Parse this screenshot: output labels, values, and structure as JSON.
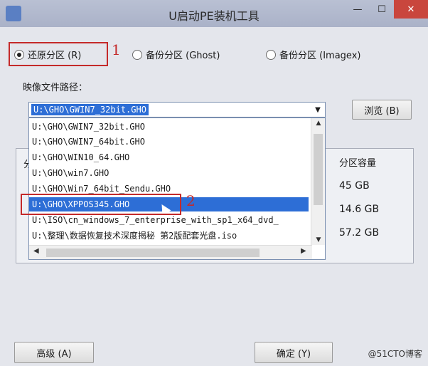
{
  "window": {
    "title": "U启动PE装机工具",
    "minimize": "—",
    "maximize": "☐",
    "close": "✕"
  },
  "restore_options": [
    {
      "label": "还原分区 (R)",
      "selected": true
    },
    {
      "label": "备份分区 (Ghost)",
      "selected": false
    },
    {
      "label": "备份分区 (Imagex)",
      "selected": false
    }
  ],
  "annotations": {
    "first": "1",
    "second": "2"
  },
  "image_path": {
    "label": "映像文件路径：",
    "value": "U:\\GHO\\GWIN7_32bit.GHO",
    "browse_label": "浏览 (B)"
  },
  "dropdown_items": [
    "U:\\GHO\\GWIN7_32bit.GHO",
    "U:\\GHO\\GWIN7_64bit.GHO",
    "U:\\GHO\\WIN10_64.GHO",
    "U:\\GHO\\win7.GHO",
    "U:\\GHO\\Win7_64bit_Sendu.GHO",
    "U:\\GHO\\XPPOS345.GHO",
    "U:\\ISO\\cn_windows_7_enterprise_with_sp1_x64_dvd_",
    "U:\\整理\\数据恢复技术深度揭秘 第2版配套光盘.iso"
  ],
  "selected_index": 5,
  "partition_table": {
    "header_fragment": "分",
    "capacity_header": "分区容量",
    "sizes": [
      "45 GB",
      "14.6 GB",
      "57.2 GB"
    ]
  },
  "buttons": {
    "advanced": "高级 (A)",
    "ok": "确定 (Y)"
  },
  "watermark": "@51CTO博客"
}
